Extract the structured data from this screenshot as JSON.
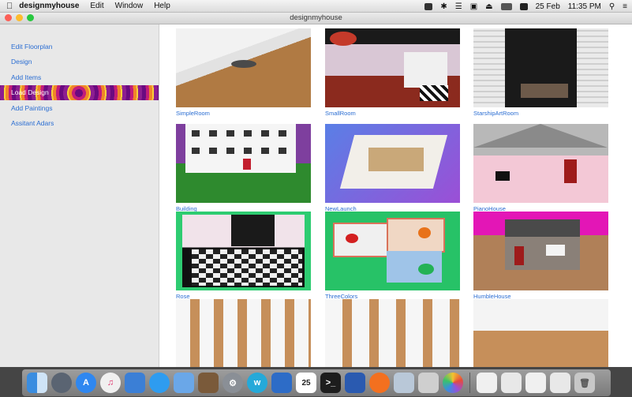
{
  "menubar": {
    "apple": "",
    "app_name": "designmyhouse",
    "items": [
      "Edit",
      "Window",
      "Help"
    ],
    "right": {
      "date": "25 Feb",
      "time": "11:35 PM"
    }
  },
  "window": {
    "title": "designmyhouse"
  },
  "sidebar": {
    "items": [
      {
        "label": "Edit Floorplan"
      },
      {
        "label": "Design"
      },
      {
        "label": "Add Items"
      },
      {
        "label": "Load Design"
      },
      {
        "label": "Add Paintings"
      },
      {
        "label": "Assitant Adars"
      }
    ],
    "active_index": 3
  },
  "designs": [
    {
      "label": "SimpleRoom"
    },
    {
      "label": "SmallRoom"
    },
    {
      "label": "StarshipArtRoom"
    },
    {
      "label": "Building"
    },
    {
      "label": "NewLaunch"
    },
    {
      "label": "PianoHouse"
    },
    {
      "label": "Rose"
    },
    {
      "label": "ThreeColors"
    },
    {
      "label": "HumbleHouse"
    }
  ],
  "dock": {
    "calendar_day": "25",
    "icons": [
      "finder-icon",
      "launchpad-icon",
      "app-store-icon",
      "music-icon",
      "xcode-icon",
      "safari-icon",
      "preview-icon",
      "xcode-instruments-icon",
      "system-preferences-icon",
      "word-icon",
      "keynote-icon",
      "calendar-icon",
      "terminal-icon",
      "visual-studio-icon",
      "firefox-icon",
      "photos-icon",
      "app-icon",
      "photos-app-icon",
      "document-icon-1",
      "document-icon-2",
      "document-icon-3",
      "document-icon-4",
      "trash-icon"
    ]
  }
}
